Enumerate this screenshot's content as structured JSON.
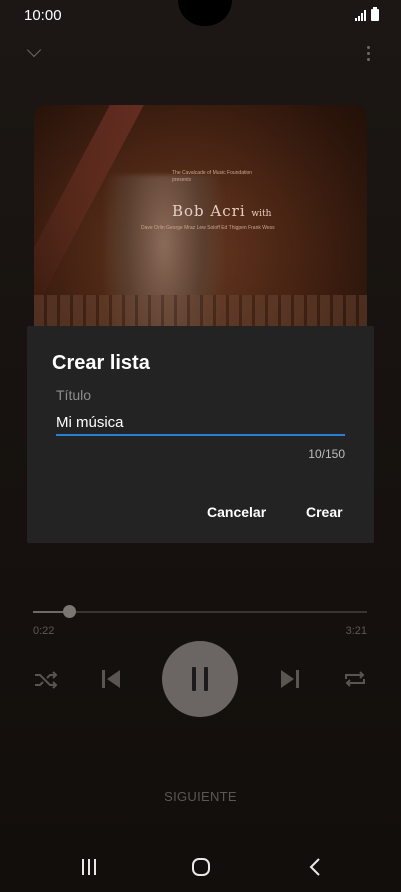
{
  "status_bar": {
    "time": "10:00"
  },
  "album": {
    "presenter_line": "The Cavalcade of Music Foundation presents",
    "artist_name": "Bob Acri",
    "artist_suffix": "with",
    "credits": "Dave Orlin George Mraz Lew Soloff Ed Thigpen Frank Wess"
  },
  "dialog": {
    "title": "Crear lista",
    "field_label": "Título",
    "field_value": "Mi música",
    "counter": "10/150",
    "cancel_label": "Cancelar",
    "create_label": "Crear"
  },
  "player": {
    "elapsed": "0:22",
    "total": "3:21",
    "progress_fraction": 0.11,
    "next_label": "SIGUIENTE"
  },
  "colors": {
    "accent": "#2a7fd6",
    "dialog_bg": "#232323",
    "play_button": "#6b6664"
  },
  "icons": {
    "collapse": "chevron-down-icon",
    "more": "more-vert-icon",
    "shuffle": "shuffle-icon",
    "previous": "skip-previous-icon",
    "pause": "pause-icon",
    "next": "skip-next-icon",
    "repeat": "repeat-icon",
    "nav_recents": "recents-icon",
    "nav_home": "home-icon",
    "nav_back": "back-icon"
  }
}
